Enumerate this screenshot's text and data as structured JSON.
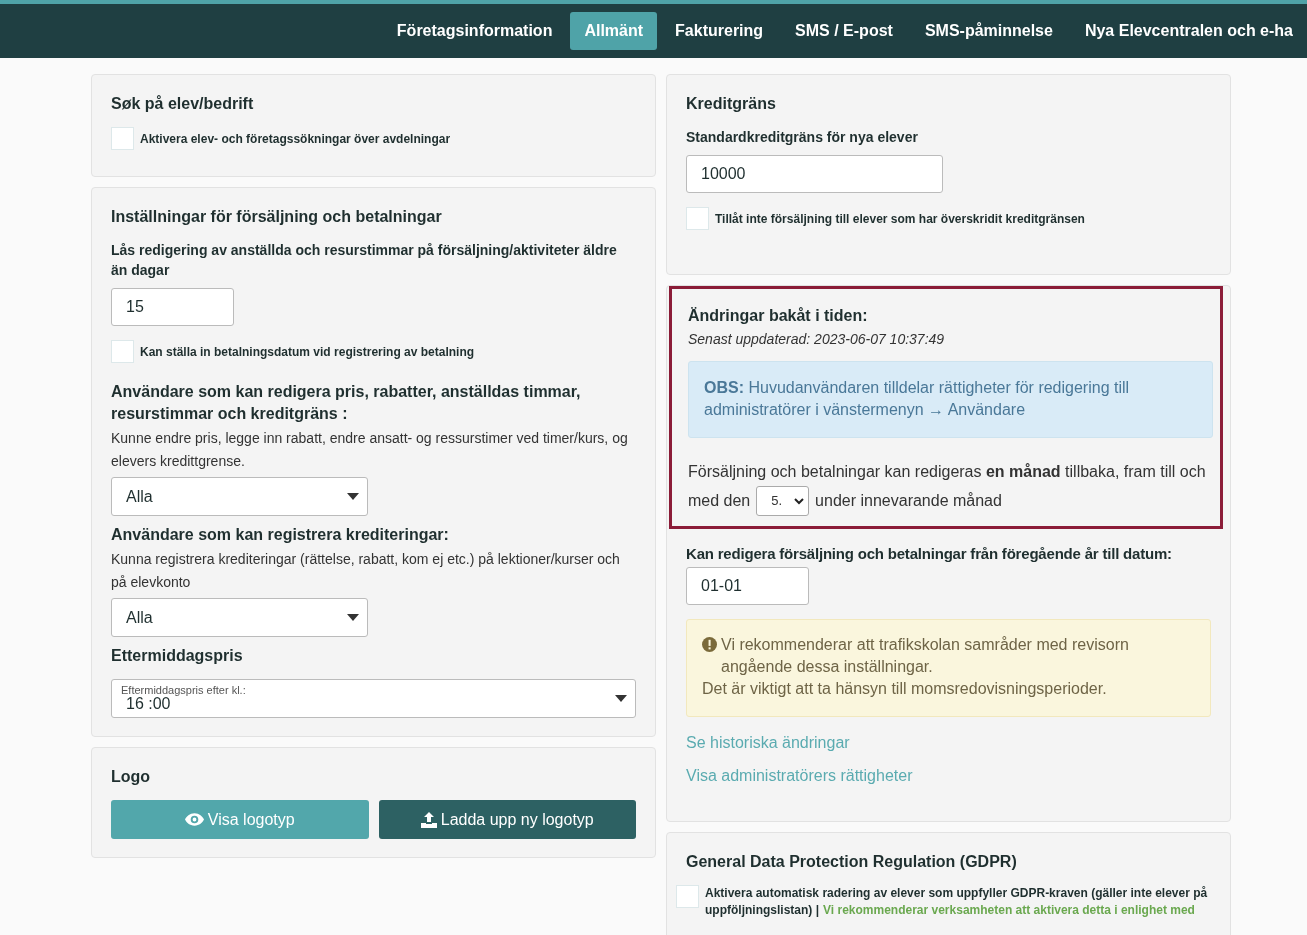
{
  "nav": {
    "tabs": [
      {
        "label": "Företagsinformation",
        "selected": false
      },
      {
        "label": "Allmänt",
        "selected": true
      },
      {
        "label": "Fakturering",
        "selected": false
      },
      {
        "label": "SMS / E-post",
        "selected": false
      },
      {
        "label": "SMS-påminnelse",
        "selected": false
      },
      {
        "label": "Nya Elevcentralen och e-ha",
        "selected": false
      }
    ]
  },
  "search_card": {
    "title": "Søk på elev/bedrift",
    "checkbox": {
      "label": "Aktivera elev- och företagssökningar över avdelningar",
      "checked": false
    }
  },
  "sales_card": {
    "title": "Inställningar för försäljning och betalningar",
    "lock_label": "Lås redigering av anställda och resurstimmar på försäljning/aktiviteter äldre än dagar",
    "lock_value": "15",
    "checkbox": {
      "label": "Kan ställa in betalningsdatum vid registrering av betalning",
      "checked": false
    },
    "groups": [
      {
        "title": "Användare som kan redigera pris, rabatter, anställdas timmar, resurstimmar och kreditgräns :",
        "description": "Kunne endre pris, legge inn rabatt, endre ansatt- og ressurstimer ved timer/kurs, og elevers kredittgrense.",
        "value": "Alla"
      },
      {
        "title": "Användare som kan registrera krediteringar:",
        "description": "Kunna registrera krediteringar (rättelse, rabatt, kom ej etc.) på lektioner/kurser och på elevkonto",
        "value": "Alla"
      }
    ],
    "afternoon": {
      "title": "Ettermiddagspris",
      "field_label": "Eftermiddagspris efter kl.:",
      "value": "16 :00"
    }
  },
  "logo_card": {
    "title": "Logo",
    "buttons": [
      {
        "label": "Visa logotyp",
        "kind": "view"
      },
      {
        "label": "Ladda upp ny logotyp",
        "kind": "upload"
      }
    ]
  },
  "credit_card": {
    "title": "Kreditgräns",
    "field_label": "Standardkreditgräns för nya elever",
    "value": "10000",
    "checkbox": {
      "label": "Tillåt inte försäljning till elever som har överskridit kreditgränsen",
      "checked": false
    }
  },
  "changes_card": {
    "title": "Ändringar bakåt i tiden:",
    "updated": "Senast uppdaterad: 2023-06-07 10:37:49",
    "info": "**OBS:** Huvudanvändaren tilldelar rättigheter för redigering till administratörer i vänstermenyn → Användare",
    "sentence_before": "Försäljning och betalningar kan redigeras **en månad** tillbaka, fram till och",
    "sentence_middle": "med den",
    "day_value": "5.",
    "sentence_after": "under innevarande månad",
    "prev_year_label": "Kan redigera försäljning och betalningar från föregående år till datum:",
    "prev_year_value": "01-01",
    "warning_lines": [
      "Vi rekommenderar att trafikskolan samråder med revisorn angående dessa inställningar.",
      "Det är viktigt att ta hänsyn till momsredovisningsperioder."
    ],
    "links": [
      "Se historiska ändringar",
      "Visa administratörers rättigheter"
    ]
  },
  "gdpr_card": {
    "title": "General Data Protection Regulation (GDPR)",
    "checkbox": {
      "label_lines": [
        "Aktivera automatisk radering av elever som uppfyller GDPR-kraven (gäller inte elever på",
        "uppföljningslistan) |"
      ],
      "note": "Vi rekommenderar verksamheten att aktivera detta i enlighet med",
      "checked": false
    }
  }
}
